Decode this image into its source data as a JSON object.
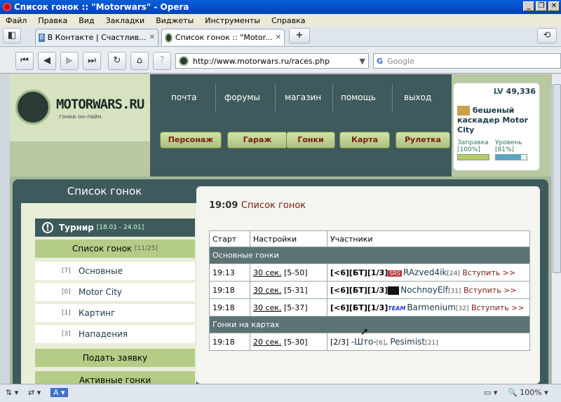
{
  "window": {
    "title": "Список гонок :: \"Motorwars\" - Opera"
  },
  "menu": [
    "Файл",
    "Правка",
    "Вид",
    "Закладки",
    "Виджеты",
    "Инструменты",
    "Справка"
  ],
  "tabs": [
    {
      "label": "В Контакте | Счастлив..."
    },
    {
      "label": "Список гонок :: \"Motor..."
    }
  ],
  "toolbar": {
    "url": "http://www.motorwars.ru/races.php",
    "search_placeholder": "Google"
  },
  "site": {
    "logo": "MOTORWARS.RU",
    "logo_sub": "гонки он-лайн",
    "nav": [
      "почта",
      "форумы",
      "магазин",
      "помощь",
      "выход"
    ],
    "buttons": [
      "Персонаж",
      "Гараж",
      "Гонки",
      "Карта",
      "Рулетка"
    ],
    "user": {
      "lv_label": "LV",
      "lv": "49,336",
      "name": "бешеный каскадер Motor City",
      "fuel_label": "Заправка",
      "fuel": "[100%]",
      "level_label": "Уровень",
      "level": "[81%]",
      "fuel_fraction": 1.0,
      "level_fraction": 0.81
    }
  },
  "sidebar": {
    "title": "Список гонок",
    "tournament": {
      "label": "Турнир",
      "dates": "[18.01 - 24.01]"
    },
    "race_list": {
      "label": "Список гонок",
      "count": "[11/25]"
    },
    "items": [
      {
        "count": "[7]",
        "label": "Основные"
      },
      {
        "count": "[0]",
        "label": "Motor City"
      },
      {
        "count": "[1]",
        "label": "Картинг"
      },
      {
        "count": "[3]",
        "label": "Нападения"
      }
    ],
    "apply": "Подать заявку",
    "active": "Активные гонки"
  },
  "main": {
    "time": "19:09",
    "title": "Список гонок",
    "headers": [
      "Старт",
      "Настройки",
      "Участники"
    ],
    "section1": "Основные гонки",
    "section2": "Гонки на картах",
    "join": "Вступить >>",
    "races": [
      {
        "start": "19:13",
        "interval": "30 сек.",
        "range": "[5-50]",
        "type": "[<6][БТ][1/3]",
        "badge": "SRS",
        "player": "RAzved4ik",
        "lvl": "[24]"
      },
      {
        "start": "19:18",
        "interval": "30 сек.",
        "range": "[5-31]",
        "type": "[<6][БТ][1/3]",
        "badge": "",
        "player": "NochnoyElf",
        "lvl": "[31]"
      },
      {
        "start": "19:18",
        "interval": "30 сек.",
        "range": "[5-37]",
        "type": "[<6][БТ][1/3]",
        "badge": "TEAM",
        "player": "Barmenium",
        "lvl": "[32]"
      }
    ],
    "kart": {
      "start": "19:18",
      "interval": "20 сек.",
      "range": "[5-30]",
      "count": "[2/3]",
      "p1": "-Што-",
      "p1lvl": "[6]",
      "p2": "Pesimist",
      "p2lvl": "[21]"
    }
  },
  "status": {
    "zoom": "100%"
  },
  "colors": {
    "title": "#0a5fd8",
    "nav": "#3f5a5c",
    "accent": "#7a1d14",
    "button": "#b5cc86"
  }
}
